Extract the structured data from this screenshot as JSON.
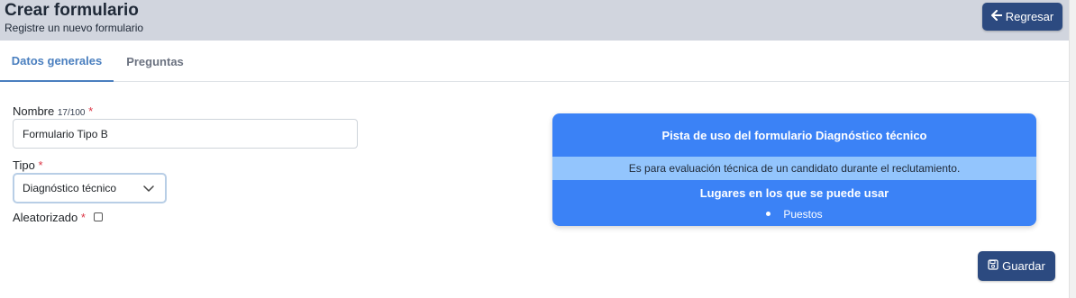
{
  "header": {
    "title": "Crear formulario",
    "subtitle": "Registre un nuevo formulario",
    "back_label": "Regresar"
  },
  "tabs": [
    {
      "label": "Datos generales",
      "active": true
    },
    {
      "label": "Preguntas",
      "active": false
    }
  ],
  "form": {
    "nombre_label": "Nombre",
    "nombre_counter": "17/100",
    "nombre_value": "Formulario Tipo B",
    "tipo_label": "Tipo",
    "tipo_value": "Diagnóstico técnico",
    "aleatorizado_label": "Aleatorizado",
    "aleatorizado_checked": false,
    "required_mark": "*"
  },
  "hint": {
    "title": "Pista de uso del formulario Diagnóstico técnico",
    "description": "Es para evaluación técnica de un candidato durante el reclutamiento.",
    "places_title": "Lugares en los que se puede usar",
    "places": [
      "Puestos"
    ]
  },
  "actions": {
    "save_label": "Guardar"
  },
  "colors": {
    "header_bg": "#d1d5de",
    "button_bg": "#2c4a80",
    "tab_active": "#4a7fbf",
    "card_bg": "#3b82f6",
    "card_band": "#93c5fd",
    "required": "#dc3545"
  },
  "icons": {
    "back": "arrow-left-icon",
    "save": "floppy-disk-icon",
    "select": "chevron-down-icon"
  }
}
